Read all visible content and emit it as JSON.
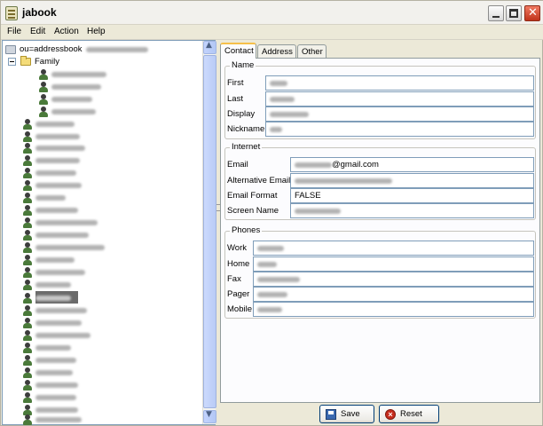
{
  "window": {
    "title": "jabook"
  },
  "menu": [
    "File",
    "Edit",
    "Action",
    "Help"
  ],
  "tree": {
    "root_label": "ou=addressbook",
    "folder_label": "Family"
  },
  "tabs": [
    "Contact",
    "Address",
    "Other"
  ],
  "groups": {
    "name": {
      "legend": "Name",
      "fields": [
        {
          "label": "First",
          "value": ""
        },
        {
          "label": "Last",
          "value": ""
        },
        {
          "label": "Display",
          "value": ""
        },
        {
          "label": "Nickname",
          "value": ""
        }
      ]
    },
    "internet": {
      "legend": "Internet",
      "fields": [
        {
          "label": "Email",
          "value_suffix": "@gmail.com"
        },
        {
          "label": "Alternative Email",
          "value": ""
        },
        {
          "label": "Email Format",
          "value": "FALSE"
        },
        {
          "label": "Screen Name",
          "value": ""
        }
      ]
    },
    "phones": {
      "legend": "Phones",
      "fields": [
        {
          "label": "Work",
          "value": ""
        },
        {
          "label": "Home",
          "value": ""
        },
        {
          "label": "Fax",
          "value": ""
        },
        {
          "label": "Pager",
          "value": ""
        },
        {
          "label": "Mobile",
          "value": ""
        }
      ]
    }
  },
  "buttons": {
    "save": "Save",
    "reset": "Reset"
  }
}
